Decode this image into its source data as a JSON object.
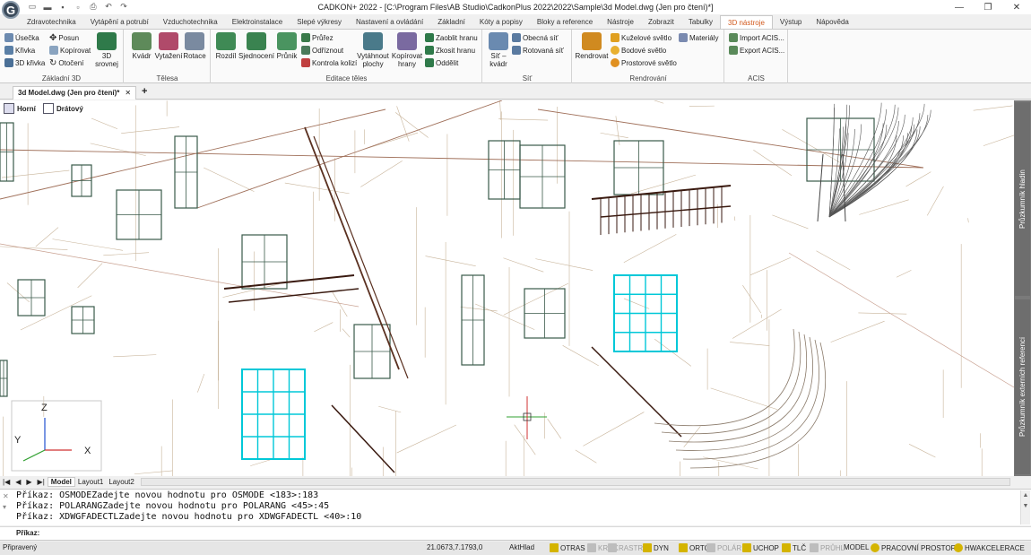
{
  "app": {
    "logo_letter": "G",
    "title": "CADKON+ 2022 - [C:\\Program Files\\AB Studio\\CadkonPlus 2022\\2022\\Sample\\3d Model.dwg (Jen pro čtení)*]"
  },
  "ribbon_tabs": [
    "Zdravotechnika",
    "Vytápění a potrubí",
    "Vzduchotechnika",
    "Elektroinstalace",
    "Slepé výkresy",
    "Nastavení a ovládání",
    "Základní",
    "Kóty a popisy",
    "Bloky a reference",
    "Nástroje",
    "Zobrazit",
    "Tabulky",
    "3D nástroje",
    "Výstup",
    "Nápověda"
  ],
  "active_tab": "3D nástroje",
  "ribbon": {
    "zaklad": {
      "title": "Základní 3D",
      "usecka": "Úsečka",
      "krivka": "Křivka",
      "krivka3d": "3D křivka",
      "posun": "Posun",
      "kopirovat": "Kopírovat",
      "otoceni": "Otočení",
      "srovnej": "3D srovnej"
    },
    "telesa": {
      "title": "Tělesa",
      "kvadr": "Kvádr",
      "vytazeni": "Vytažení",
      "rotace": "Rotace"
    },
    "editace": {
      "title": "Editace těles",
      "rozdil": "Rozdíl",
      "sjednoceni": "Sjednocení",
      "prunik": "Průnik",
      "prurez": "Průřez",
      "odriznout": "Odříznout",
      "kontrola": "Kontrola kolizí",
      "vytahnout": "Vytáhnout plochy",
      "kopirovat_hrany": "Kopírovat hrany",
      "zaoblit": "Zaoblit hranu",
      "zkosit": "Zkosit hranu",
      "oddelit": "Oddělit"
    },
    "sit": {
      "title": "Síť",
      "sit_kvadr": "Síť – kvádr",
      "obecna": "Obecná síť",
      "rotovana": "Rotovaná síť"
    },
    "rendr": {
      "title": "Rendrování",
      "rendrovat": "Rendrovat",
      "kuzelove": "Kuželové světlo",
      "bodove": "Bodové světlo",
      "prostorove": "Prostorové světlo",
      "materialy": "Materiály"
    },
    "acis": {
      "title": "ACIS",
      "import": "Import ACIS...",
      "export": "Export ACIS..."
    }
  },
  "document_tab": "3d Model.dwg (Jen pro čtení)*",
  "view_labels": {
    "view": "Horní",
    "style": "Drátový"
  },
  "ucs": {
    "z": "Z",
    "y": "Y",
    "x": "X"
  },
  "side_panels": [
    "Průzkumník hladin",
    "Průzkumník externích referencí"
  ],
  "layout_tabs": [
    "Model",
    "Layout1",
    "Layout2"
  ],
  "command_history": [
    "Příkaz: OSMODEZadejte novou hodnotu pro OSMODE <183>:183",
    "Příkaz: POLARANGZadejte novou hodnotu pro POLARANG <45>:45",
    "Příkaz: XDWGFADECTLZadejte novou hodnotu pro XDWGFADECTL <40>:10"
  ],
  "command_prompt": "Příkaz:",
  "status": {
    "ready": "Připravený",
    "coords": "21.0673,7.1793,0",
    "toggles": [
      "AktHlad",
      "OTRAS",
      "KROK",
      "RASTR",
      "DYN",
      "ORTO",
      "POLÁR",
      "UCHOP",
      "TLČ",
      "PRŮHL",
      "MODEL",
      "PRACOVNÍ PROSTOR",
      "HWAKCELERACE"
    ],
    "accent": "#d4b400"
  }
}
